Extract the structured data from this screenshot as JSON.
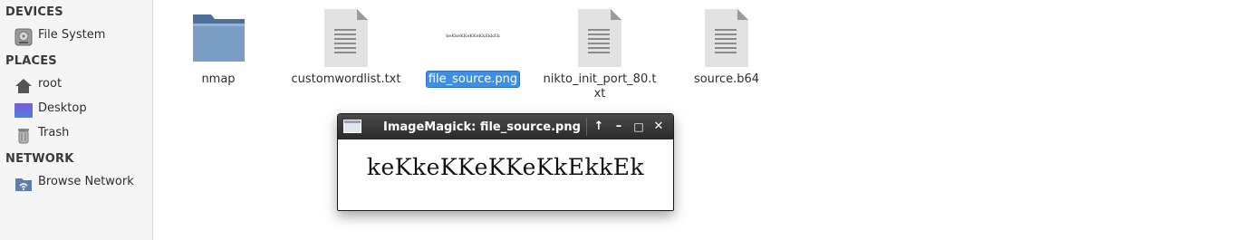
{
  "sidebar": {
    "sections": {
      "devices": "DEVICES",
      "places": "PLACES",
      "network": "NETWORK"
    },
    "devices": [
      {
        "label": "File System",
        "icon": "drive-icon"
      }
    ],
    "places": [
      {
        "label": "root",
        "icon": "home-icon"
      },
      {
        "label": "Desktop",
        "icon": "desktop-icon"
      },
      {
        "label": "Trash",
        "icon": "trash-icon"
      }
    ],
    "network": [
      {
        "label": "Browse Network",
        "icon": "network-icon"
      }
    ]
  },
  "files": [
    {
      "name": "nmap",
      "type": "folder"
    },
    {
      "name": "customwordlist.txt",
      "type": "text"
    },
    {
      "name": "file_source.png",
      "type": "image",
      "selected": true,
      "thumb_text": "keKkeKKeKKeKkEkkEk"
    },
    {
      "name_line1": "nikto_init_port_80.t",
      "name_line2": "xt",
      "type": "text"
    },
    {
      "name": "source.b64",
      "type": "text"
    }
  ],
  "window": {
    "title": "ImageMagick: file_source.png",
    "buttons": {
      "raise": "↑",
      "minimize": "–",
      "maximize": "□",
      "close": "✕"
    },
    "content_text": "keKkeKKeKKeKkEkkEk"
  },
  "colors": {
    "selection": "#3c8fe6",
    "titlebar": "#2a2a2a",
    "folder": "#6e8fb6"
  }
}
